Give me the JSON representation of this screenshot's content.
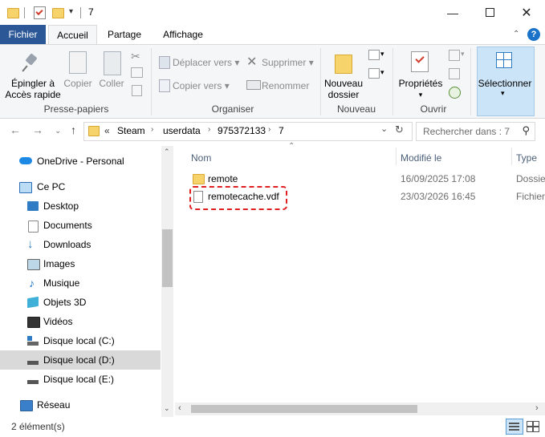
{
  "titlebar": {
    "title": "7",
    "icons": [
      "folder-icon",
      "properties-icon",
      "new-folder-icon",
      "customize-dropdown-icon"
    ],
    "controls": [
      "minimize",
      "maximize",
      "close"
    ]
  },
  "ribbon_tabs": {
    "file": "Fichier",
    "home": "Accueil",
    "share": "Partage",
    "view": "Affichage"
  },
  "ribbon": {
    "clipboard": {
      "label": "Presse-papiers",
      "pin_l1": "Épingler à",
      "pin_l2": "Accès rapide",
      "copy": "Copier",
      "paste": "Coller"
    },
    "organize": {
      "label": "Organiser",
      "move_to": "Déplacer vers",
      "copy_to": "Copier vers",
      "delete": "Supprimer",
      "rename": "Renommer"
    },
    "new": {
      "label": "Nouveau",
      "new_folder_l1": "Nouveau",
      "new_folder_l2": "dossier"
    },
    "open": {
      "label": "Ouvrir",
      "properties": "Propriétés"
    },
    "select": {
      "label": "Sélectionner"
    }
  },
  "address": {
    "overflow": "«",
    "crumbs": [
      "Steam",
      "userdata",
      "975372133",
      "7"
    ],
    "search_placeholder": "Rechercher dans : 7"
  },
  "nav": {
    "onedrive": "OneDrive - Personal",
    "thispc": "Ce PC",
    "desktop": "Desktop",
    "documents": "Documents",
    "downloads": "Downloads",
    "images": "Images",
    "music": "Musique",
    "objects3d": "Objets 3D",
    "videos": "Vidéos",
    "disk_c": "Disque local (C:)",
    "disk_d": "Disque local (D:)",
    "disk_e": "Disque local (E:)",
    "network": "Réseau"
  },
  "columns": {
    "name": "Nom",
    "modified": "Modifié le",
    "type": "Type"
  },
  "files": [
    {
      "name": "remote",
      "modified": "16/09/2025 17:08",
      "type": "Dossie"
    },
    {
      "name": "remotecache.vdf",
      "modified": "23/03/2026 16:45",
      "type": "Fichier"
    }
  ],
  "status": {
    "count": "2 élément(s)"
  },
  "colors": {
    "file_tab": "#2b5797",
    "highlight_box": "#e02020",
    "folder": "#f6d36b",
    "nav_selected": "#d9d9d9"
  }
}
